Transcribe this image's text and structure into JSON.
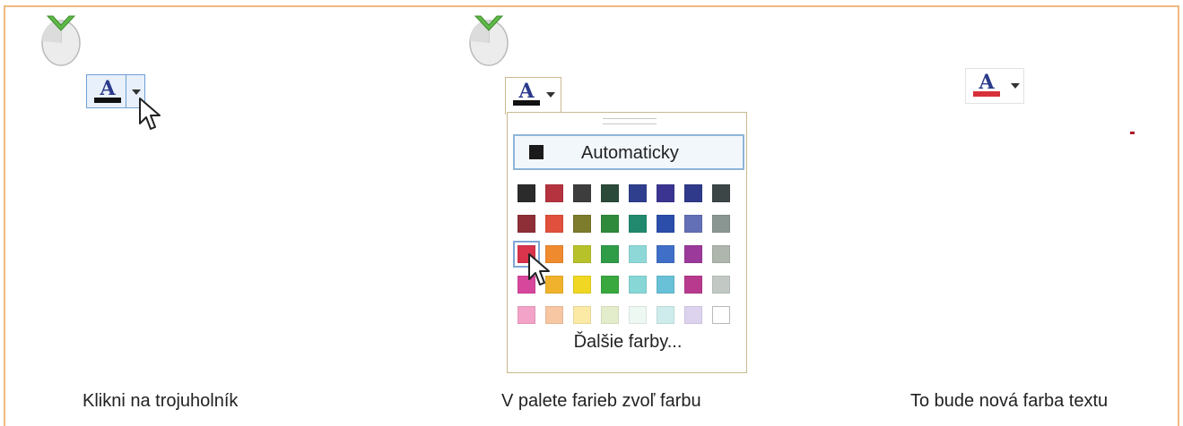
{
  "steps": [
    {
      "caption": "Klikni na trojuholník",
      "font_color_bar": "#111111"
    },
    {
      "caption": "V palete farieb zvoľ farbu",
      "font_color_bar": "#111111"
    },
    {
      "caption": "To bude nová farba textu",
      "font_color_bar": "#d6313a"
    }
  ],
  "button": {
    "glyph": "A"
  },
  "palette": {
    "automatic_label": "Automaticky",
    "automatic_color": "#1a1a1a",
    "more_colors_label": "Ďalšie farby...",
    "selected": {
      "row": 2,
      "col": 0
    },
    "rows": [
      [
        "#2b2b2b",
        "#b5323f",
        "#3d3d3d",
        "#2c4a3a",
        "#2f3f8e",
        "#3b3591",
        "#2f3a8a",
        "#3d4647"
      ],
      [
        "#8e2f38",
        "#e0503c",
        "#7d7b2c",
        "#2f8a3b",
        "#218a6e",
        "#2b4eaa",
        "#6470b5",
        "#8a9692"
      ],
      [
        "#d8334a",
        "#ef8a2e",
        "#b7c22a",
        "#2f9c47",
        "#8fd8d8",
        "#3f6fc7",
        "#9b3a9a",
        "#aeb6ad"
      ],
      [
        "#d7479c",
        "#f0b22c",
        "#efd723",
        "#39a83f",
        "#86d7d6",
        "#68c1d6",
        "#b73a8e",
        "#c2c9c4"
      ],
      [
        "#f2a3c7",
        "#f7c6a2",
        "#fbe9a6",
        "#e4edcb",
        "#eef8f2",
        "#cdeceb",
        "#ddd3ee",
        "#ffffff"
      ]
    ]
  },
  "colors": {
    "frame": "#f0b980",
    "mouse_highlight": "#6fbf4a"
  }
}
